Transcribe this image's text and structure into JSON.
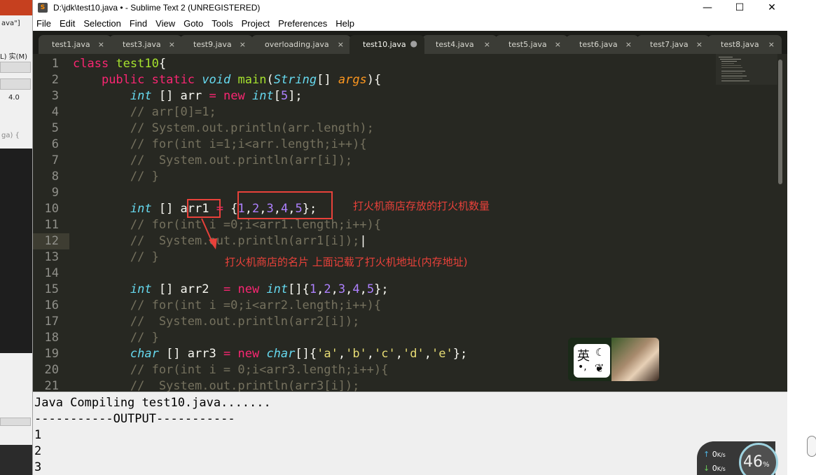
{
  "window": {
    "title": "D:\\jdk\\test10.java • - Sublime Text 2 (UNREGISTERED)",
    "controls": [
      "—",
      "☐",
      "✕"
    ]
  },
  "menu": [
    "File",
    "Edit",
    "Selection",
    "Find",
    "View",
    "Goto",
    "Tools",
    "Project",
    "Preferences",
    "Help"
  ],
  "tabs": [
    {
      "label": "test1.java",
      "close": "×"
    },
    {
      "label": "test3.java",
      "close": "×"
    },
    {
      "label": "test9.java",
      "close": "×"
    },
    {
      "label": "overloading.java",
      "close": "×"
    },
    {
      "label": "test10.java",
      "close": "●"
    },
    {
      "label": "test4.java",
      "close": "×"
    },
    {
      "label": "test5.java",
      "close": "×"
    },
    {
      "label": "test6.java",
      "close": "×"
    },
    {
      "label": "test7.java",
      "close": "×"
    },
    {
      "label": "test8.java",
      "close": "×"
    }
  ],
  "active_tab_index": 4,
  "current_line": 12,
  "line_numbers": [
    "1",
    "2",
    "3",
    "4",
    "5",
    "6",
    "7",
    "8",
    "9",
    "10",
    "11",
    "12",
    "13",
    "14",
    "15",
    "16",
    "17",
    "18",
    "19",
    "20",
    "21"
  ],
  "annotations": {
    "array_note": "打火机商店存放的打火机数量",
    "name_note": "打火机商店的名片 上面记载了打火机地址(内存地址)"
  },
  "output": {
    "lines": [
      "Java Compiling test10.java.......",
      "-----------OUTPUT-----------",
      "1",
      "2",
      "3"
    ]
  },
  "ime": {
    "char": "英",
    "moon": "☾",
    "dots": "•,",
    "butterfly": "❦"
  },
  "network": {
    "up": "0",
    "down": "0",
    "unit": "K/s",
    "percent": "46",
    "percent_sign": "%"
  },
  "background_window": {
    "a": "ava\"]",
    "b": "L)  实(M)",
    "c": "4.0",
    "d": "ga) {"
  }
}
